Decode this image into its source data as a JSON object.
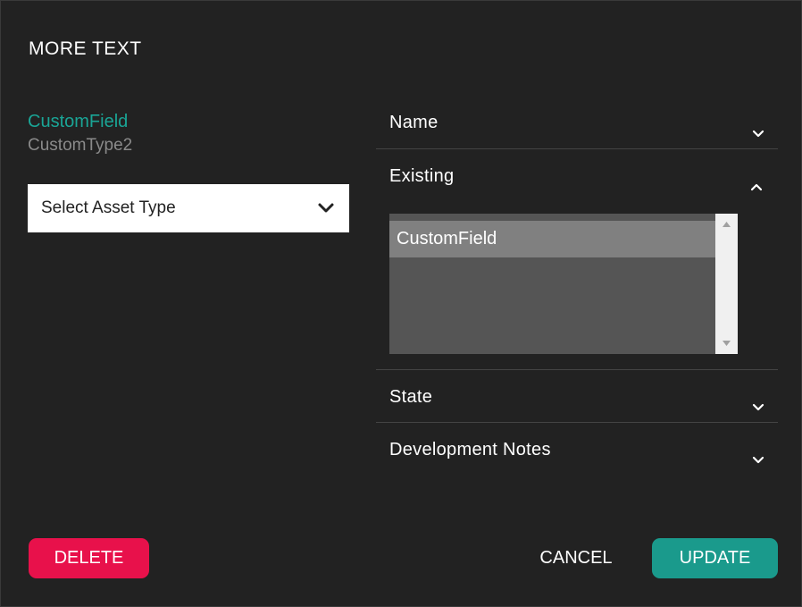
{
  "dialog": {
    "title": "MORE TEXT"
  },
  "field": {
    "name": "CustomField",
    "type": "CustomType2"
  },
  "asset_select": {
    "selected": "Select Asset Type",
    "icon": "chevron-down-icon"
  },
  "sections": [
    {
      "label": "Name",
      "expanded": false
    },
    {
      "label": "Existing",
      "expanded": true
    },
    {
      "label": "State",
      "expanded": false
    },
    {
      "label": "Development Notes",
      "expanded": false
    }
  ],
  "existing_list": {
    "items": [
      "CustomField"
    ]
  },
  "buttons": {
    "delete": "DELETE",
    "cancel": "CANCEL",
    "update": "UPDATE"
  },
  "colors": {
    "background": "#222222",
    "accent_teal": "#1a9a8c",
    "field_name": "#1aa596",
    "danger": "#e8114b"
  }
}
